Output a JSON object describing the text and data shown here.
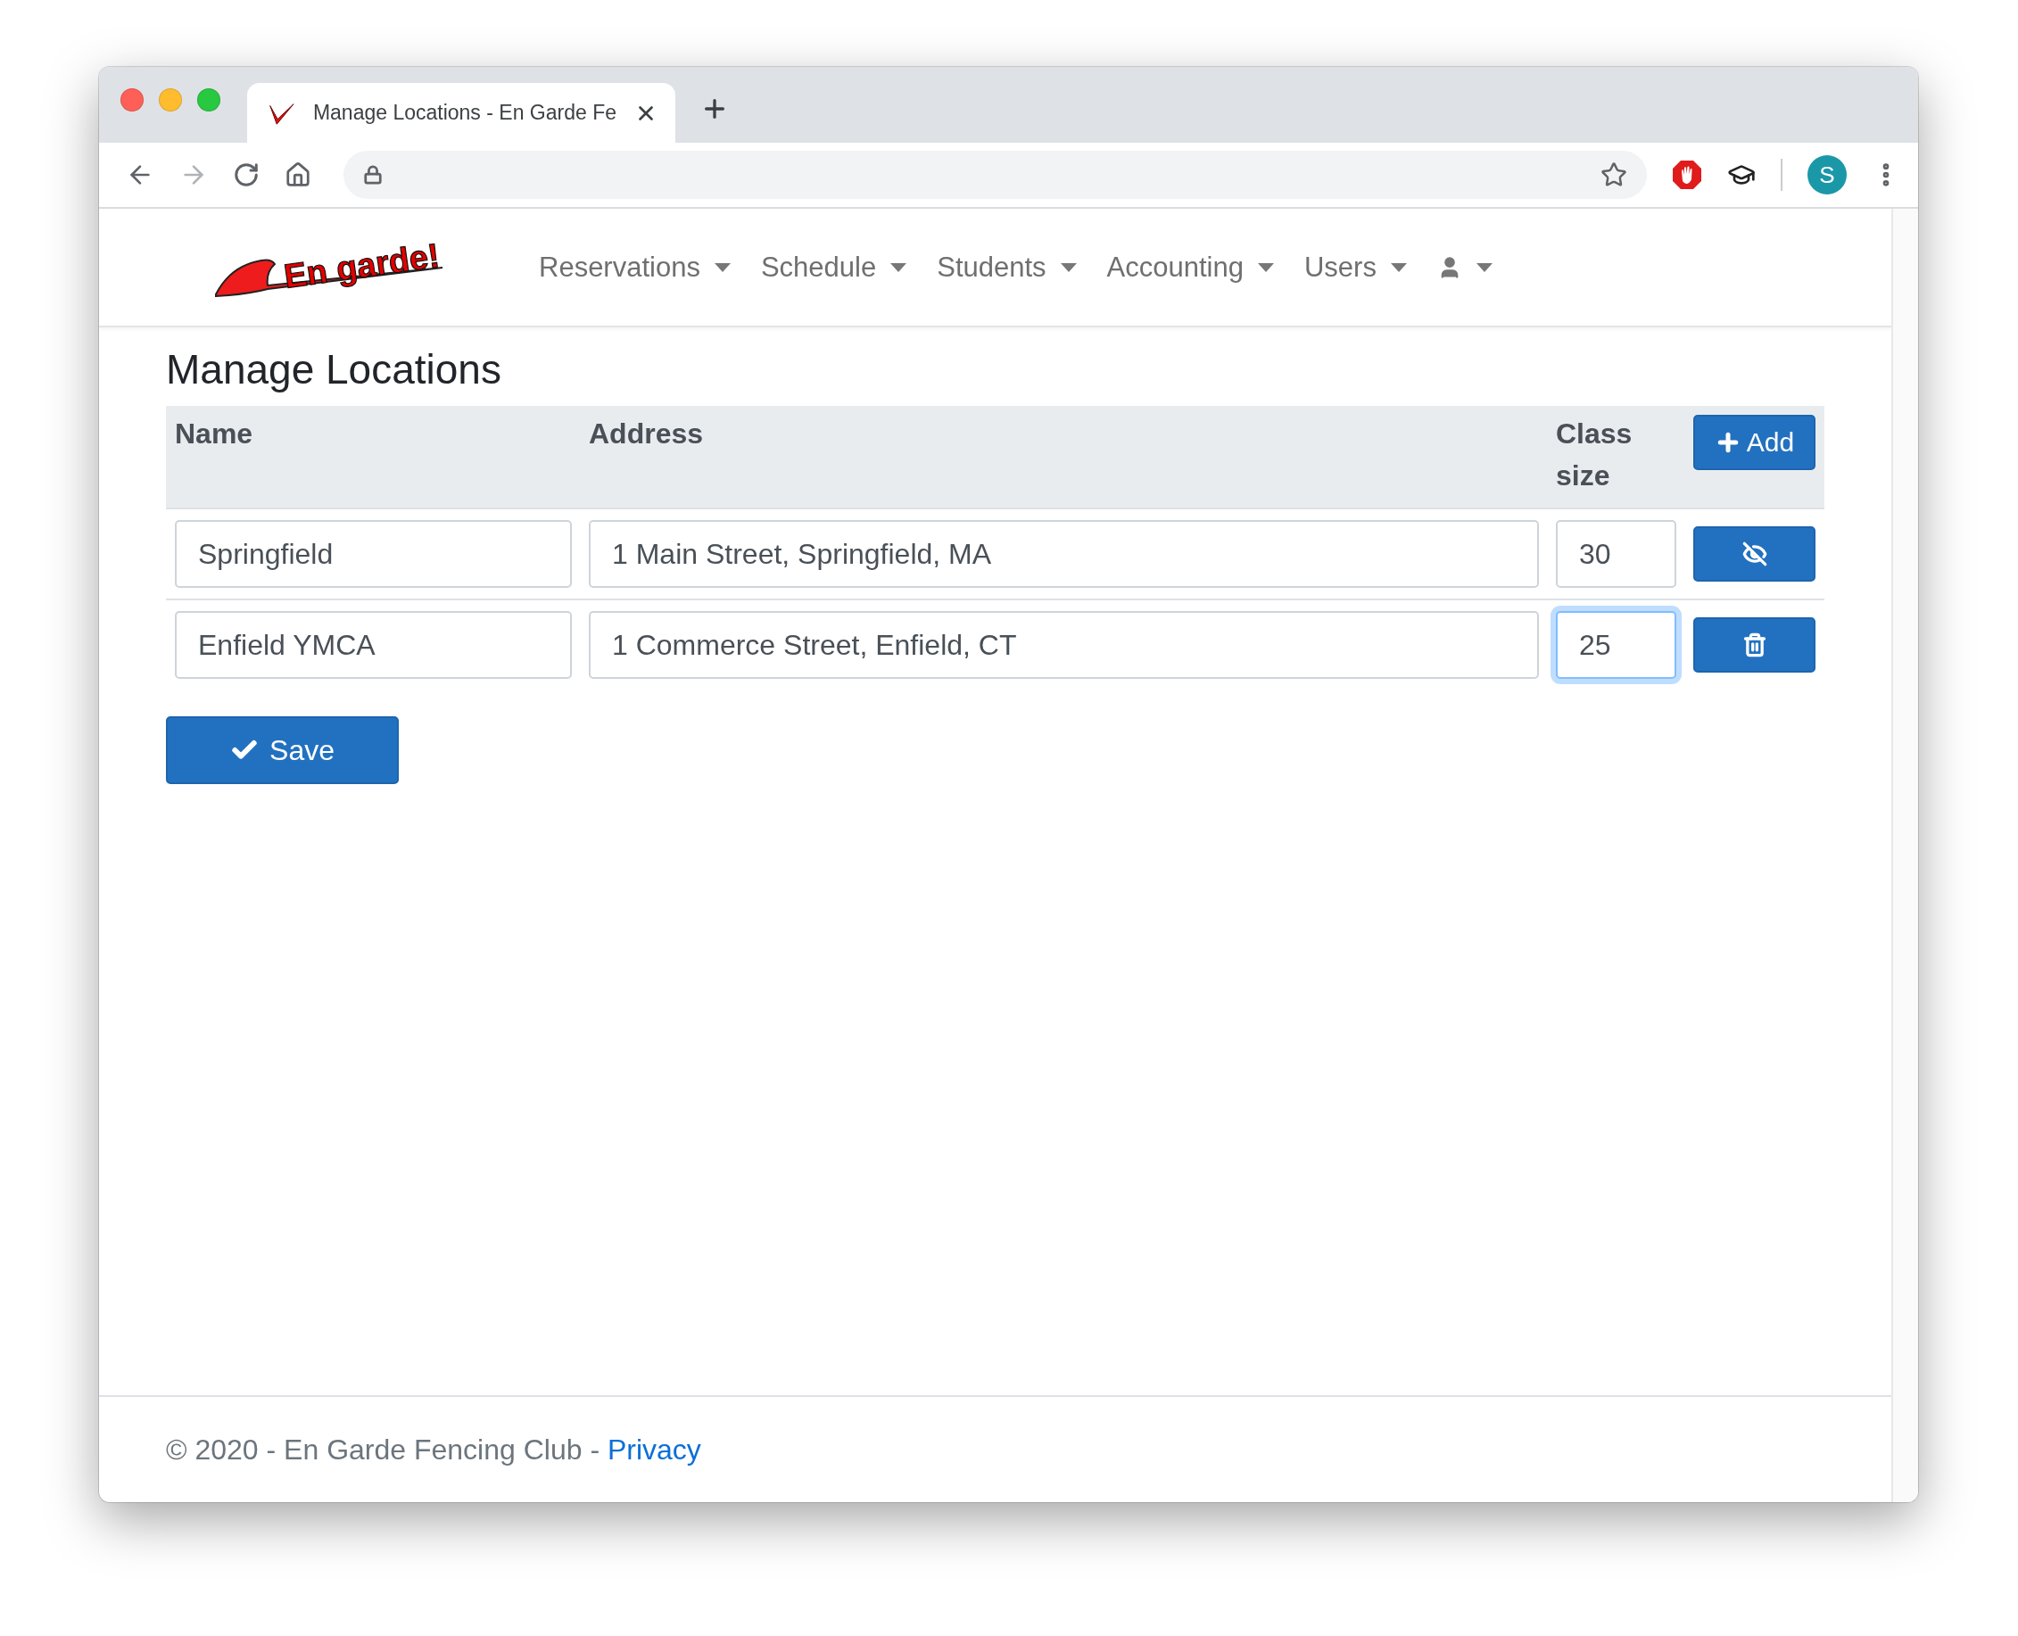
{
  "browser": {
    "tab_title": "Manage Locations - En Garde Fe",
    "profile_initial": "S"
  },
  "navbar": {
    "logo": "En garde!",
    "menus": [
      {
        "label": "Reservations"
      },
      {
        "label": "Schedule"
      },
      {
        "label": "Students"
      },
      {
        "label": "Accounting"
      },
      {
        "label": "Users"
      }
    ],
    "user_menu": true
  },
  "page_title": "Manage Locations",
  "table": {
    "columns": [
      "Name",
      "Address",
      "Class size"
    ],
    "add_button": "Add",
    "rows": [
      {
        "name": "Springfield",
        "address": "1 Main Street, Springfield, MA",
        "class_size": "30",
        "focused": false,
        "kind": "hide"
      },
      {
        "name": "Enfield YMCA",
        "address": "1 Commerce Street, Enfield, CT",
        "class_size": "25",
        "focused": true,
        "kind": "delete"
      }
    ]
  },
  "save_button": "Save",
  "footer": {
    "text": "© 2020 - En Garde Fencing Club - ",
    "link": "Privacy"
  }
}
